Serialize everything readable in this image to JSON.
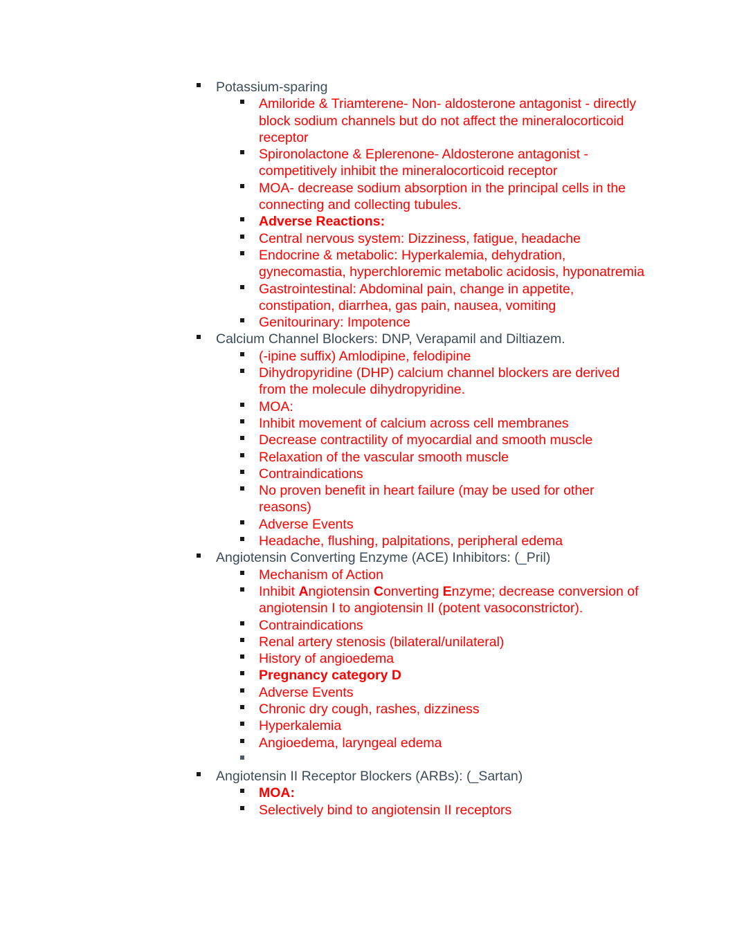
{
  "document": {
    "text_color_level1": "#3B4B57",
    "text_color_level2": "#FF0000",
    "bullet_glyph": "square-bullet"
  },
  "outline": [
    {
      "level": 1,
      "text": "Potassium-sparing",
      "bold": false
    },
    {
      "level": 2,
      "text": "Amiloride & Triamterene- Non- aldosterone antagonist - directly block sodium channels but do not affect the mineralocorticoid receptor",
      "bold": false
    },
    {
      "level": 2,
      "text": "Spironolactone & Eplerenone-  Aldosterone antagonist - competitively inhibit the mineralocorticoid receptor",
      "bold": false
    },
    {
      "level": 2,
      "text": "MOA- decrease sodium absorption in the principal cells in the connecting and collecting tubules.",
      "bold": false
    },
    {
      "level": 2,
      "text": "Adverse Reactions:",
      "bold": true
    },
    {
      "level": 2,
      "text": "Central nervous system: Dizziness, fatigue, headache",
      "bold": false
    },
    {
      "level": 2,
      "text": "Endocrine & metabolic: Hyperkalemia, dehydration, gynecomastia, hyperchloremic metabolic acidosis, hyponatremia",
      "bold": false
    },
    {
      "level": 2,
      "text": "Gastrointestinal: Abdominal pain, change in appetite, constipation, diarrhea, gas pain, nausea, vomiting",
      "bold": false
    },
    {
      "level": 2,
      "text": "Genitourinary: Impotence",
      "bold": false
    },
    {
      "level": 1,
      "text": "Calcium Channel Blockers: DNP, Verapamil and Diltiazem.",
      "bold": false
    },
    {
      "level": 2,
      "text": "(-ipine suffix) Amlodipine, felodipine",
      "bold": false
    },
    {
      "level": 2,
      "text": "Dihydropyridine (DHP) calcium channel blockers are derived from the molecule dihydropyridine.",
      "bold": false
    },
    {
      "level": 2,
      "text": "MOA:",
      "bold": false
    },
    {
      "level": 2,
      "text": "Inhibit movement of calcium across cell membranes",
      "bold": false
    },
    {
      "level": 2,
      "text": "Decrease contractility of myocardial and smooth muscle",
      "bold": false
    },
    {
      "level": 2,
      "text": "Relaxation of the vascular smooth muscle",
      "bold": false
    },
    {
      "level": 2,
      "text": "Contraindications",
      "bold": false
    },
    {
      "level": 2,
      "text": "No proven benefit in heart failure (may be used for other reasons)",
      "bold": false
    },
    {
      "level": 2,
      "text": "Adverse Events",
      "bold": false
    },
    {
      "level": 2,
      "text": "Headache, flushing, palpitations, peripheral edema",
      "bold": false
    },
    {
      "level": 1,
      "text": "Angiotensin Converting Enzyme (ACE) Inhibitors: (_Pril)",
      "bold": false
    },
    {
      "level": 2,
      "text": "Mechanism of Action",
      "bold": false
    },
    {
      "level": 2,
      "html": true,
      "text": "Inhibit <b class=\"cap\">A</b>ngiotensin <b class=\"cap\">C</b>onverting <b class=\"cap\">E</b>nzyme; decrease conversion of angiotensin I to angiotensin II (potent vasoconstrictor).",
      "plain": "Inhibit Angiotensin Converting Enzyme; decrease conversion of angiotensin I to angiotensin II (potent vasoconstrictor).",
      "bold": false
    },
    {
      "level": 2,
      "text": "Contraindications",
      "bold": false
    },
    {
      "level": 2,
      "text": "Renal artery stenosis (bilateral/unilateral)",
      "bold": false
    },
    {
      "level": 2,
      "text": "History of angioedema",
      "bold": false
    },
    {
      "level": 2,
      "text": "Pregnancy category D",
      "bold": true
    },
    {
      "level": 2,
      "text": "Adverse Events",
      "bold": false
    },
    {
      "level": 2,
      "text": "Chronic dry cough, rashes, dizziness",
      "bold": false
    },
    {
      "level": 2,
      "text": "Hyperkalemia",
      "bold": false
    },
    {
      "level": 2,
      "text": "Angioedema, laryngeal edema",
      "bold": false
    },
    {
      "level": 2,
      "text": "",
      "bold": false,
      "empty": true
    },
    {
      "level": 1,
      "text": "Angiotensin II Receptor Blockers (ARBs): (_Sartan)",
      "bold": false
    },
    {
      "level": 2,
      "text": "MOA:",
      "bold": true
    },
    {
      "level": 2,
      "text": "Selectively bind to angiotensin II receptors",
      "bold": false
    }
  ]
}
